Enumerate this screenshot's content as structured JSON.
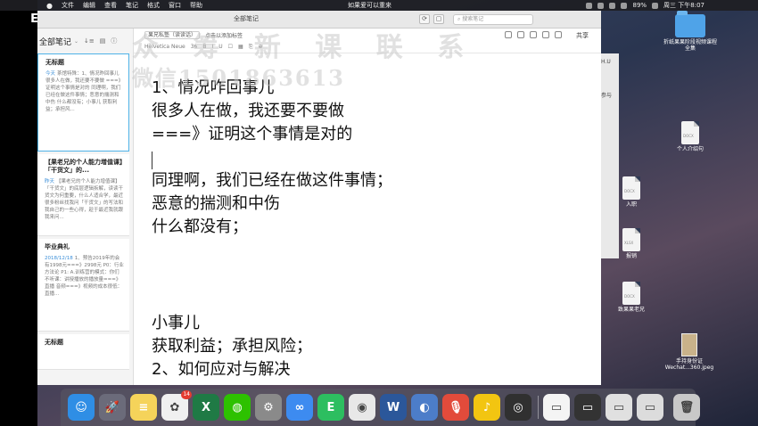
{
  "menubar": {
    "apple": "",
    "app_name": "Evernote",
    "items": [
      "文件",
      "编辑",
      "查看",
      "笔记",
      "格式",
      "窗口",
      "帮助"
    ],
    "now_playing": "如果爱可以重来",
    "battery": "89%",
    "clock": "周三 下午8:07"
  },
  "window": {
    "title": "全部笔记",
    "search_placeholder": "搜索笔记"
  },
  "notelist": {
    "header": "全部笔记",
    "notes": [
      {
        "title": "无标题",
        "date": "今天",
        "preview": "茶馆特殊：1、情况昨回事儿 很多人在做，我还要不要做 ===》证明这个事情是对的 同理啊，我们已经在做这件事情；恶意的揣测和中伤 什么都没有；小事儿 获取利益；承担风..."
      },
      {
        "title": "【果老兄的个人能力增值课】「干货文」的...",
        "date": "昨天",
        "preview": "【果老兄的个人能力增值课】「干货文」的底层逻辑拆解，读读干货文为何重要，什么人适合学，最近很多粉丝找我问「干货文」的写法和我自己的一些心得，趁于最近我就跟我来问..."
      },
      {
        "title": "毕业典礼",
        "date": "2018/12/18",
        "preview": "1、预告2019年的会有1998元===》2998元 P0：行业方法论 P1: A.训练营的模式：你们不听课：讲授播放的播放量===》直播 音频===》视频的成本很低：直播..."
      },
      {
        "title": "无标题",
        "date": "",
        "preview": ""
      }
    ]
  },
  "editor": {
    "notebook": "果兄私塾（读读话）",
    "tag_hint": "点击以添加标签",
    "share": "共享",
    "font": "Helvetica Neue",
    "font_size": "36",
    "lines": [
      "1、情况咋回事儿",
      "很多人在做，我还要不要做",
      "===》证明这个事情是对的",
      "同理啊，我们已经在做这件事情；",
      "恶意的揣测和中伤",
      "什么都没有；",
      "小事儿",
      "获取利益；承担风险；",
      "2、如何应对与解决"
    ]
  },
  "watermark": {
    "line1": "众 筹 新 课 联 系",
    "line2": "微信15018636​13"
  },
  "desktop": {
    "icons": [
      {
        "label": "折纸果果阶段视频课程全集",
        "kind": "folder"
      },
      {
        "label": "个人介绍句",
        "kind": "docx"
      },
      {
        "label": "入职",
        "kind": "docx"
      },
      {
        "label": "报销",
        "kind": "xlsx"
      },
      {
        "label": "致果果老兄",
        "kind": "docx"
      },
      {
        "label": "手持身份证 Wechat...360.jpeg",
        "kind": "image"
      }
    ],
    "partial_window_text": [
      "H.U",
      "参与"
    ]
  },
  "dock": {
    "apps": [
      {
        "name": "finder",
        "color": "#2f8ee5",
        "glyph": "☺"
      },
      {
        "name": "launchpad",
        "color": "#6b6b7a",
        "glyph": "🚀"
      },
      {
        "name": "notes",
        "color": "#f5d35a",
        "glyph": "≡"
      },
      {
        "name": "photos",
        "color": "#f0f0f0",
        "glyph": "✿",
        "badge": "14"
      },
      {
        "name": "excel",
        "color": "#1f7a45",
        "glyph": "X"
      },
      {
        "name": "wechat",
        "color": "#2dc100",
        "glyph": "◍"
      },
      {
        "name": "system-preferences",
        "color": "#8a8a8a",
        "glyph": "⚙"
      },
      {
        "name": "baidu-netdisk",
        "color": "#3d8bf0",
        "glyph": "∞"
      },
      {
        "name": "evernote",
        "color": "#2dbe60",
        "glyph": "E"
      },
      {
        "name": "chrome",
        "color": "#e8e8e8",
        "glyph": "◉"
      },
      {
        "name": "word",
        "color": "#2b579a",
        "glyph": "W"
      },
      {
        "name": "network-tool",
        "color": "#4c7dc9",
        "glyph": "◐"
      },
      {
        "name": "voice-memo",
        "color": "#e24b3b",
        "glyph": "🎙"
      },
      {
        "name": "qq-music",
        "color": "#f2c511",
        "glyph": "♪"
      },
      {
        "name": "obs",
        "color": "#303030",
        "glyph": "◎"
      },
      {
        "name": "preview-1",
        "color": "#f4f4f4",
        "glyph": "▭"
      },
      {
        "name": "preview-2",
        "color": "#333333",
        "glyph": "▭"
      },
      {
        "name": "preview-3",
        "color": "#e0e0e0",
        "glyph": "▭"
      },
      {
        "name": "preview-4",
        "color": "#dcdcdc",
        "glyph": "▭"
      },
      {
        "name": "trash",
        "color": "#c8c8c8",
        "glyph": "🗑"
      }
    ]
  }
}
